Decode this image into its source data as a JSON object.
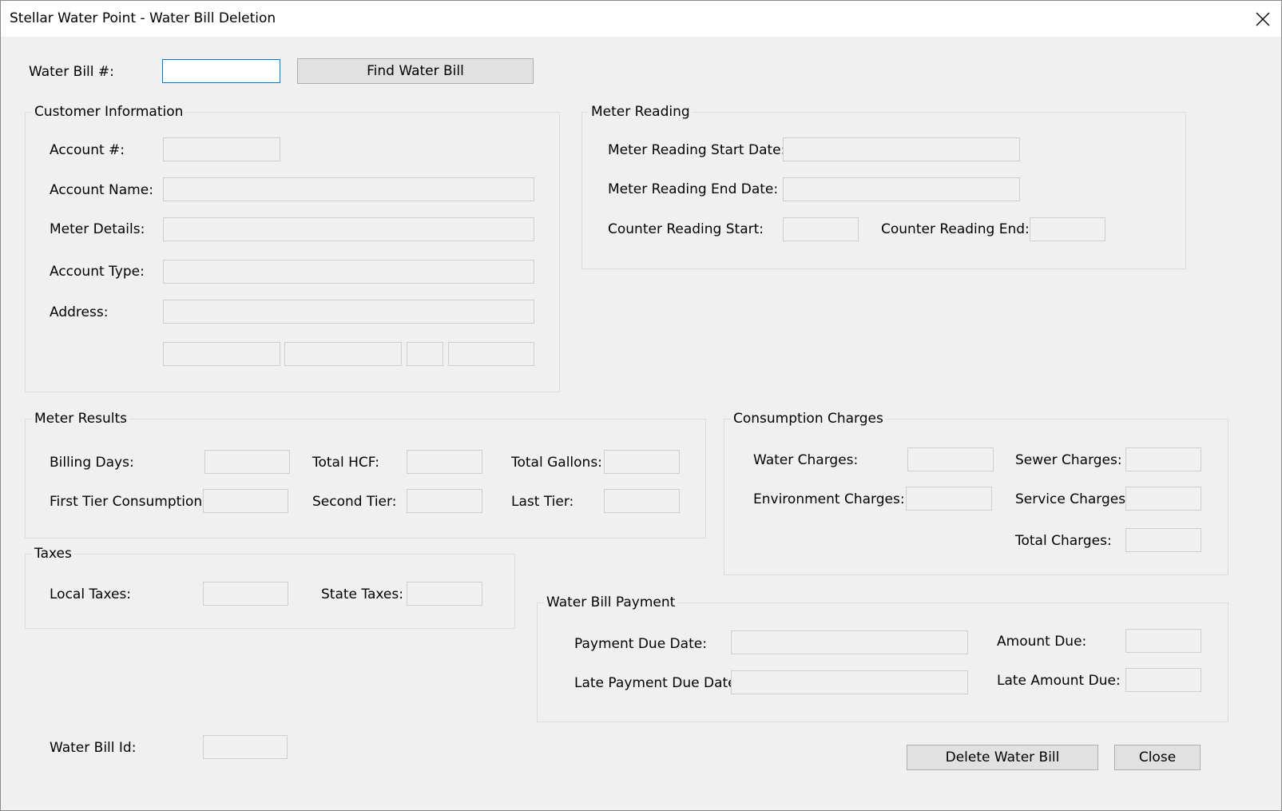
{
  "window": {
    "title": "Stellar Water Point - Water Bill Deletion"
  },
  "find": {
    "label": "Water Bill #:",
    "value": "",
    "button": "Find Water Bill"
  },
  "customer": {
    "title": "Customer Information",
    "account_number_label": "Account #:",
    "account_name_label": "Account Name:",
    "meter_details_label": "Meter Details:",
    "account_type_label": "Account Type:",
    "address_label": "Address:"
  },
  "meter_reading": {
    "title": "Meter Reading",
    "start_date_label": "Meter Reading Start Date:",
    "end_date_label": "Meter Reading End Date:",
    "counter_start_label": "Counter Reading Start:",
    "counter_end_label": "Counter Reading End:"
  },
  "meter_results": {
    "title": "Meter Results",
    "billing_days_label": "Billing Days:",
    "total_hcf_label": "Total HCF:",
    "total_gallons_label": "Total Gallons:",
    "first_tier_label": "First Tier Consumption:",
    "second_tier_label": "Second Tier:",
    "last_tier_label": "Last Tier:"
  },
  "consumption": {
    "title": "Consumption Charges",
    "water_label": "Water Charges:",
    "sewer_label": "Sewer Charges:",
    "environment_label": "Environment Charges:",
    "service_label": "Service Charges:",
    "total_label": "Total Charges:"
  },
  "taxes": {
    "title": "Taxes",
    "local_label": "Local Taxes:",
    "state_label": "State Taxes:"
  },
  "payment": {
    "title": "Water Bill Payment",
    "due_date_label": "Payment Due Date:",
    "amount_due_label": "Amount Due:",
    "late_date_label": "Late Payment Due Date:",
    "late_amount_label": "Late Amount Due:"
  },
  "footer": {
    "bill_id_label": "Water Bill Id:",
    "delete_button": "Delete Water Bill",
    "close_button": "Close"
  }
}
